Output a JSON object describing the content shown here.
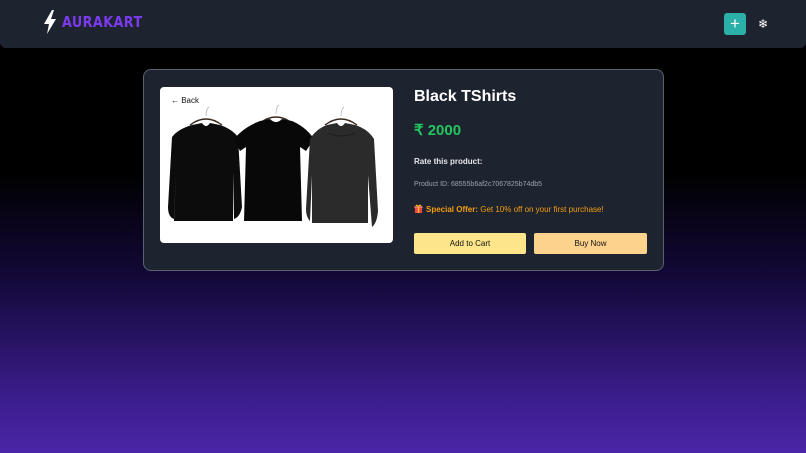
{
  "navbar": {
    "brand": "AURAKART",
    "brand_color": "#7c3aed",
    "add_label": "+",
    "theme_glyph": "❄",
    "icons": [
      "bolt-icon",
      "plus-icon",
      "snowflake-icon"
    ]
  },
  "product": {
    "back_label": "← Back",
    "title": "Black TShirts",
    "price": "₹ 2000",
    "price_color": "#22c55e",
    "rate_label": "Rate this product:",
    "product_id": "Product ID: 68555b6af2c7067825b74db5",
    "offer_strong": "Special Offer:",
    "offer_text": " Get 10% off on your first purchase!",
    "offer_color": "#f59e0b",
    "add_to_cart": "Add to Cart",
    "buy_now": "Buy Now"
  }
}
